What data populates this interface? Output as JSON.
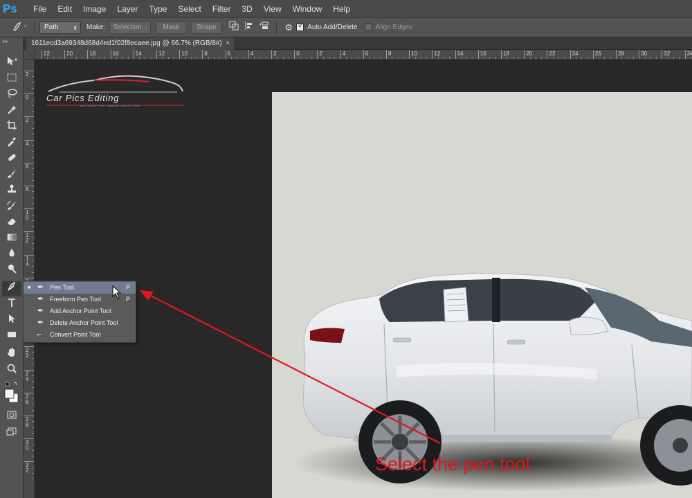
{
  "app": {
    "logo": "Ps"
  },
  "menu": [
    "File",
    "Edit",
    "Image",
    "Layer",
    "Type",
    "Select",
    "Filter",
    "3D",
    "View",
    "Window",
    "Help"
  ],
  "options": {
    "mode_value": "Path",
    "make_label": "Make:",
    "selection_button": "Selection...",
    "mask_button": "Mask",
    "shape_button": "Shape",
    "auto_add_delete": "Auto Add/Delete",
    "auto_add_delete_checked": true,
    "align_edges": "Align Edges",
    "align_edges_checked": false
  },
  "document": {
    "tab_title": "1611ecd3a69348d68d4ed1f02f8ecaee.jpg @ 66.7% (RGB/8#)",
    "close": "×"
  },
  "ruler": {
    "top_labels": [
      "22",
      "20",
      "18",
      "16",
      "14",
      "12",
      "10",
      "8",
      "6",
      "4",
      "2",
      "0",
      "2",
      "4",
      "6",
      "8",
      "10",
      "12",
      "14",
      "16",
      "18",
      "20",
      "22",
      "24",
      "26",
      "28",
      "30",
      "32",
      "34",
      "36"
    ],
    "left_labels": [
      "2",
      "0",
      "2",
      "4",
      "6",
      "8",
      "1 0",
      "1 2",
      "1 4",
      "1 6",
      "1 8",
      "2 0",
      "2 2",
      "2 4",
      "2 6",
      "2 8",
      "3 0",
      "3 2"
    ]
  },
  "logo": {
    "brand": "Car Pics Editing",
    "tagline": "AUTOMOTIVE IMAGE SOLUTION",
    "accent": "#d9242a"
  },
  "flyout": {
    "items": [
      {
        "label": "Pen Tool",
        "key": "P",
        "active": true
      },
      {
        "label": "Freeform Pen Tool",
        "key": "P",
        "active": false
      },
      {
        "label": "Add Anchor Point Tool",
        "key": "",
        "active": false
      },
      {
        "label": "Delete Anchor Point Tool",
        "key": "",
        "active": false
      },
      {
        "label": "Convert Point Tool",
        "key": "",
        "active": false
      }
    ]
  },
  "annotation": {
    "text": "Select the pen tool",
    "color": "#e2161c"
  },
  "colors": {
    "accent": "#31a8ff",
    "photo_bg": "#d8d8d3",
    "car_body": "#eef0f2"
  }
}
